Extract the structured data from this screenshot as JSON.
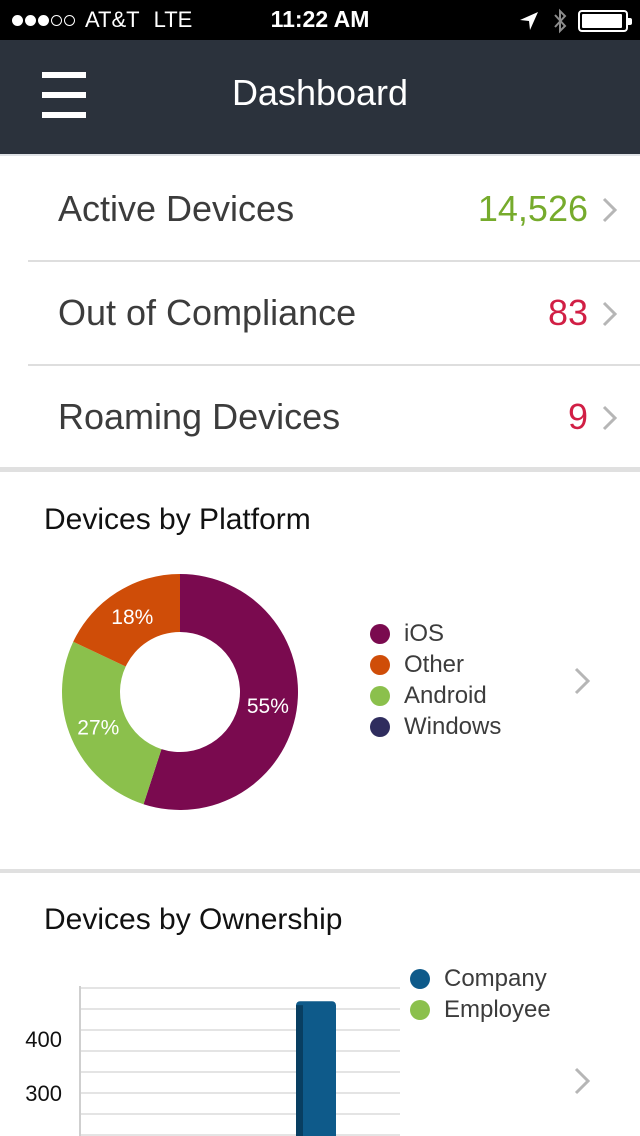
{
  "status_bar": {
    "signal_bars": 3,
    "signal_total": 5,
    "carrier": "AT&T",
    "network": "LTE",
    "time": "11:22 AM",
    "icons": [
      "location-arrow-icon",
      "bluetooth-icon",
      "battery-icon"
    ],
    "battery_level": 0.95
  },
  "nav": {
    "title": "Dashboard",
    "menu_icon": "hamburger-menu-icon"
  },
  "summary": [
    {
      "label": "Active Devices",
      "value": "14,526",
      "color": "#76ab2c"
    },
    {
      "label": "Out of Compliance",
      "value": "83",
      "color": "#d11f45"
    },
    {
      "label": "Roaming Devices",
      "value": "9",
      "color": "#d11f45"
    }
  ],
  "platform": {
    "title": "Devices by Platform",
    "legend": [
      {
        "label": "iOS",
        "color": "#7a0a4f"
      },
      {
        "label": "Other",
        "color": "#cf4d08"
      },
      {
        "label": "Android",
        "color": "#8bc04c"
      },
      {
        "label": "Windows",
        "color": "#2f2d5e"
      }
    ],
    "chart_data": {
      "type": "pie",
      "slices": [
        {
          "label": "iOS",
          "value": 55,
          "display": "55%",
          "color": "#7a0a4f"
        },
        {
          "label": "Android",
          "value": 27,
          "display": "27%",
          "color": "#8bc04c"
        },
        {
          "label": "Other",
          "value": 18,
          "display": "18%",
          "color": "#cf4d08"
        }
      ]
    }
  },
  "ownership": {
    "title": "Devices by Ownership",
    "legend": [
      {
        "label": "Company",
        "color": "#0e5a8a"
      },
      {
        "label": "Employee",
        "color": "#8bc04c"
      }
    ],
    "chart_data": {
      "type": "bar",
      "y_tick_labels": [
        "400",
        "300"
      ],
      "y_ticks": [
        400,
        300
      ],
      "series": [
        {
          "name": "Company",
          "color": "#0e5a8a",
          "values": [
            470
          ]
        }
      ]
    }
  }
}
